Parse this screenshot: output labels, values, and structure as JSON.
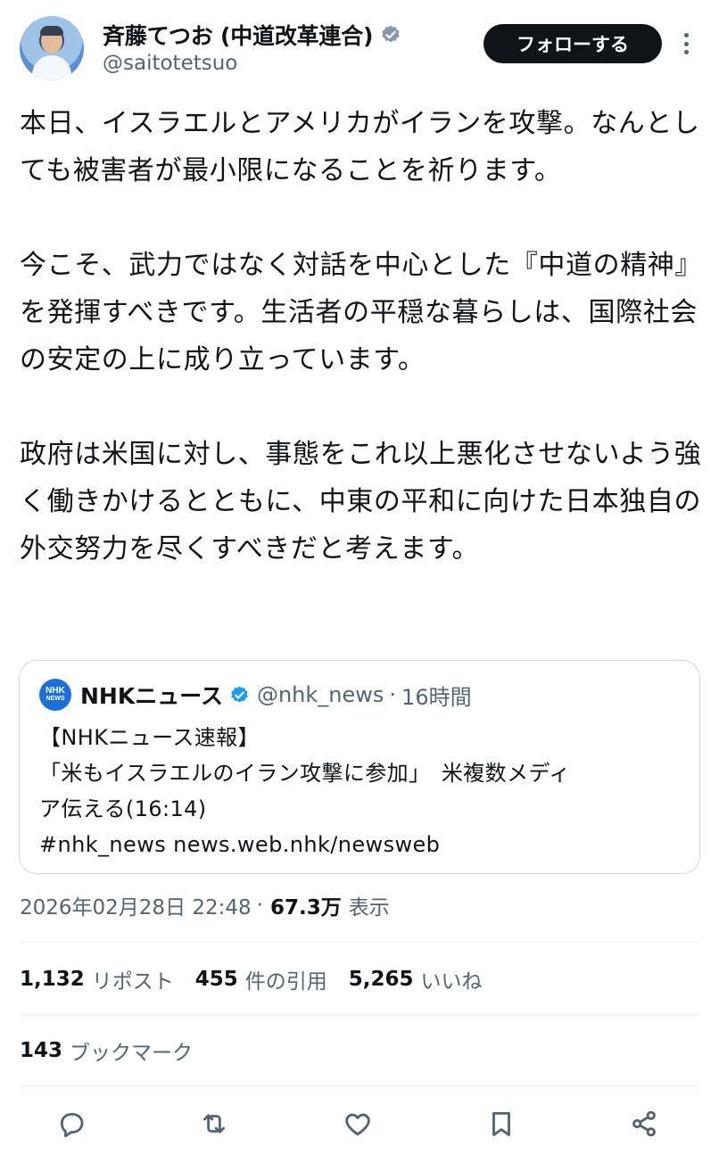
{
  "author": {
    "display_name": "斉藤てつお (中道改革連合)",
    "handle": "@saitotetsuo",
    "verified_color": "#829aab"
  },
  "follow_label": "フォローする",
  "tweet": {
    "paragraphs": [
      "本日、イスラエルとアメリカがイランを攻撃。なんとしても被害者が最小限になることを祈ります。",
      "今こそ、武力ではなく対話を中心とした『中道の精神』を発揮すべきです。生活者の平穏な暮らしは、国際社会の安定の上に成り立っています。",
      "政府は米国に対し、事態をこれ以上悪化させないよう強く働きかけるとともに、中東の平和に向けた日本独自の外交努力を尽くすべきだと考えます。"
    ]
  },
  "quote": {
    "logo_line1": "NHK",
    "logo_line2": "NEWS",
    "name": "NHKニュース",
    "handle": "@nhk_news",
    "separator": "·",
    "time": "16時間",
    "verified_color": "#1d9bf0",
    "lines": [
      "【NHKニュース速報】",
      "「米もイスラエルのイラン攻撃に参加」　米複数メディ",
      "ア伝える(16:14)",
      "#nhk_news news.web.nhk/newsweb"
    ]
  },
  "meta": {
    "timestamp": "2026年02月28日 22:48",
    "separator": "·",
    "views": "67.3万",
    "views_label": "表示"
  },
  "stats": {
    "reposts": "1,132",
    "reposts_label": "リポスト",
    "quotes": "455",
    "quotes_label": "件の引用",
    "likes": "5,265",
    "likes_label": "いいね"
  },
  "bookmarks": {
    "count": "143",
    "label": "ブックマーク"
  },
  "actions": [
    "reply-icon",
    "repost-icon",
    "like-icon",
    "bookmark-icon",
    "share-icon"
  ]
}
